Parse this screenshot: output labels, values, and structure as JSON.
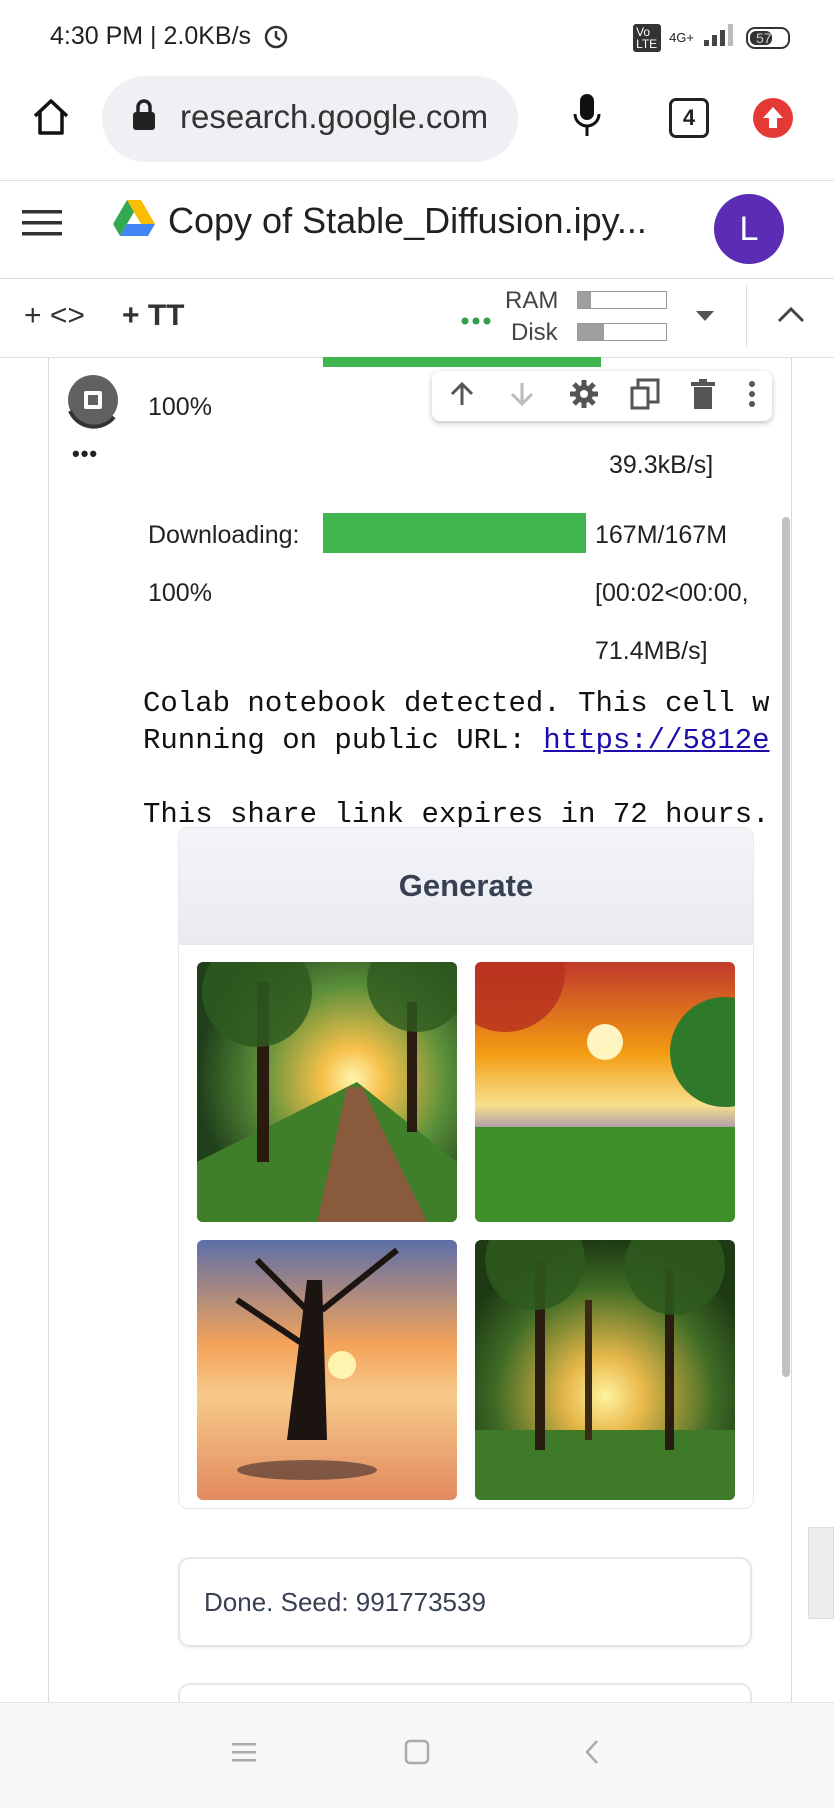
{
  "status_bar": {
    "time": "4:30 PM | 2.0KB/s",
    "network": "4G+",
    "volte": "Vo LTE",
    "battery": "57"
  },
  "chrome": {
    "url": "research.google.com",
    "tab_count": "4"
  },
  "colab": {
    "notebook_title": "Copy of Stable_Diffusion.ipy...",
    "avatar_initial": "L",
    "toolbar": {
      "add_code": "+ <>",
      "add_text": "+ TT",
      "ram_label": "RAM",
      "disk_label": "Disk",
      "ram_usage": 0.15,
      "disk_usage": 0.3
    }
  },
  "output": {
    "first_progress_percent": "100%",
    "first_speed": "39.3kB/s]",
    "download_label": "Downloading:",
    "download_size": "167M/167M",
    "download_percent": "100%",
    "download_time": "[00:02<00:00,",
    "download_speed": "71.4MB/s]",
    "ellipsis": "•••",
    "log_line1": "Colab notebook detected. This cell w",
    "log_line2_prefix": "Running on public URL: ",
    "log_line2_link": "https://5812e",
    "log_line3": "This share link expires in 72 hours."
  },
  "gradio": {
    "generate_label": "Generate",
    "images": [
      "forest-path-sunset",
      "meadow-sunset-red-leaves",
      "tree-in-water-sunset",
      "forest-sunrise"
    ],
    "status_text": "Done. Seed: 991773539"
  },
  "colors": {
    "progress_green": "#3fb54e",
    "avatar_purple": "#5b2db5",
    "link_blue": "#1a0dab"
  }
}
